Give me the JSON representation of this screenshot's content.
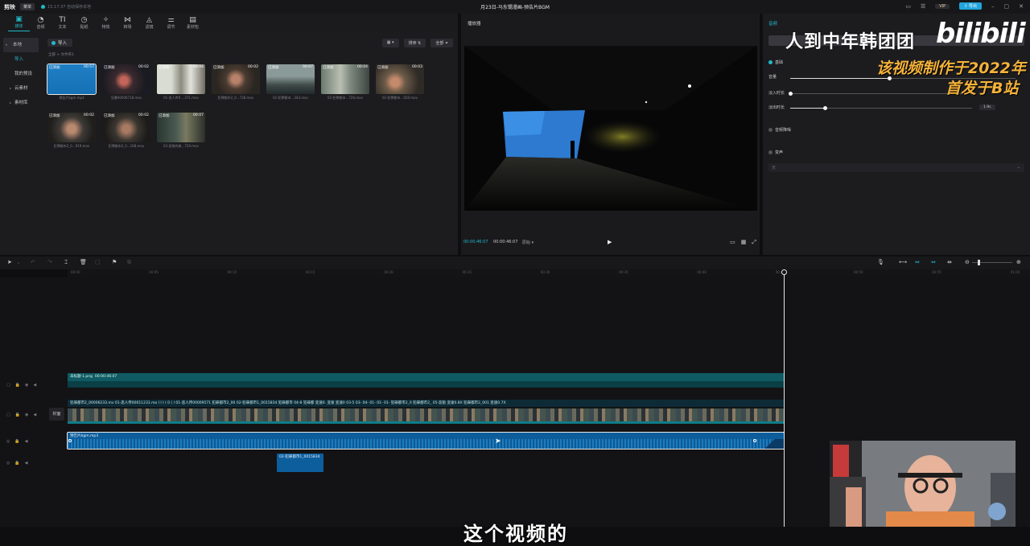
{
  "app": {
    "logo": "剪映",
    "menu_label": "菜单",
    "save_status": "15:17:37 自动保存本地",
    "doc_title": "月23日-马东锡漫画-预告片BGM",
    "vip": "VIP",
    "export_label": "导出"
  },
  "toolbar": {
    "items": [
      {
        "label": "媒体",
        "icon": "media-icon"
      },
      {
        "label": "音频",
        "icon": "audio-icon"
      },
      {
        "label": "文本",
        "icon": "text-icon"
      },
      {
        "label": "贴纸",
        "icon": "sticker-icon"
      },
      {
        "label": "特效",
        "icon": "effects-icon"
      },
      {
        "label": "转场",
        "icon": "transition-icon"
      },
      {
        "label": "滤镜",
        "icon": "filter-icon"
      },
      {
        "label": "调节",
        "icon": "adjust-icon"
      },
      {
        "label": "素材包",
        "icon": "package-icon"
      }
    ]
  },
  "sidebar": {
    "items": [
      {
        "label": "本地"
      },
      {
        "label": "导入"
      },
      {
        "label": "我的预设"
      },
      {
        "label": "云素材"
      },
      {
        "label": "素材库"
      }
    ]
  },
  "media": {
    "import_label": "导入",
    "breadcrumb": "全部 > 文件夹1",
    "sort_label": "排序",
    "filter_label": "全部",
    "tag_label": "已添加",
    "items": [
      {
        "name": "预告片bgm.mp3",
        "duration": "00:57"
      },
      {
        "name": "狂暴00006718.mov",
        "duration": "00:02"
      },
      {
        "name": "01-恶人传0....371.mov",
        "duration": "00:04"
      },
      {
        "name": "犯罪都市2_0...738.mov",
        "duration": "00:02"
      },
      {
        "name": "02-犯罪都市...343.mov",
        "duration": "00:07"
      },
      {
        "name": "02-犯罪都市...726.mov",
        "duration": "00:04"
      },
      {
        "name": "02-犯罪都市...020.mov",
        "duration": "00:03"
      },
      {
        "name": "犯罪都市2_0...919.mov",
        "duration": "00:02"
      },
      {
        "name": "犯罪都市2_0...108.mov",
        "duration": "00:02"
      },
      {
        "name": "03-恶狼的夜...720.mov",
        "duration": "00:07"
      }
    ]
  },
  "player": {
    "title": "播放器",
    "current": "00:00:46:07",
    "total": "00:00:46:07",
    "ratio": "原始"
  },
  "props": {
    "tab": "音频",
    "basic": "基础",
    "volume": "音量",
    "fade_in": "淡入时长",
    "fade_out": "淡出时长",
    "fade_out_value": "1.9s",
    "volume_level": 0.44,
    "fade_in_level": 0.0,
    "fade_out_level": 0.19,
    "denoise": "音频降噪",
    "voice_change": "变声",
    "voice_value": "无"
  },
  "watermark": {
    "line1": "人到中年韩团团",
    "logo": "bilibili",
    "line2": "该视频制作于2022年",
    "line3": "首发于B站"
  },
  "timeline": {
    "ruler": [
      "00:00",
      "00:05",
      "00:10",
      "00:15",
      "00:20",
      "00:25",
      "00:30",
      "00:35",
      "00:40",
      "00:45",
      "00:50",
      "00:55",
      "01:00"
    ],
    "cover_label": "封面",
    "text_clip": {
      "name": "未标题-1.png",
      "duration": "00:00:46:07"
    },
    "video_clip_label": "犯罪都市2_00006233.mv  01-恶人传00011231.mo  I  I  I   (  0  (  I  01-恶人传00009571  犯罪都市2_00  02-犯罪都市1_0015834  犯罪都市  04-8  犯罪都  变速0.  变速  变速0  03-5  03-  04-  01-  01-  01-  犯罪都市2_0  犯罪都市2_  05-恶狼  变速0.8X  犯罪都市2_001  变速0.7X",
    "audio_clip": "预告片bgm.mp3",
    "extra_clip": "02-犯罪都市1_0015834"
  },
  "subtitle": "这个视频的"
}
